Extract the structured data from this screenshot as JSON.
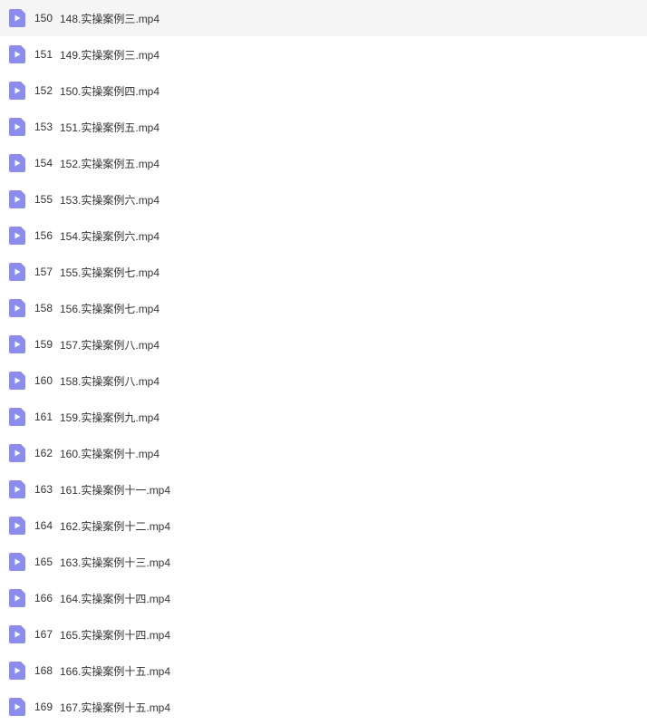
{
  "icon_fill": "#8a8cf0",
  "play_fill": "#ffffff",
  "files": [
    {
      "index": "150",
      "name": "148.实操案例三.mp4"
    },
    {
      "index": "151",
      "name": "149.实操案例三.mp4"
    },
    {
      "index": "152",
      "name": "150.实操案例四.mp4"
    },
    {
      "index": "153",
      "name": "151.实操案例五.mp4"
    },
    {
      "index": "154",
      "name": "152.实操案例五.mp4"
    },
    {
      "index": "155",
      "name": "153.实操案例六.mp4"
    },
    {
      "index": "156",
      "name": "154.实操案例六.mp4"
    },
    {
      "index": "157",
      "name": "155.实操案例七.mp4"
    },
    {
      "index": "158",
      "name": "156.实操案例七.mp4"
    },
    {
      "index": "159",
      "name": "157.实操案例八.mp4"
    },
    {
      "index": "160",
      "name": "158.实操案例八.mp4"
    },
    {
      "index": "161",
      "name": "159.实操案例九.mp4"
    },
    {
      "index": "162",
      "name": "160.实操案例十.mp4"
    },
    {
      "index": "163",
      "name": "161.实操案例十一.mp4"
    },
    {
      "index": "164",
      "name": "162.实操案例十二.mp4"
    },
    {
      "index": "165",
      "name": "163.实操案例十三.mp4"
    },
    {
      "index": "166",
      "name": "164.实操案例十四.mp4"
    },
    {
      "index": "167",
      "name": "165.实操案例十四.mp4"
    },
    {
      "index": "168",
      "name": "166.实操案例十五.mp4"
    },
    {
      "index": "169",
      "name": "167.实操案例十五.mp4"
    }
  ]
}
